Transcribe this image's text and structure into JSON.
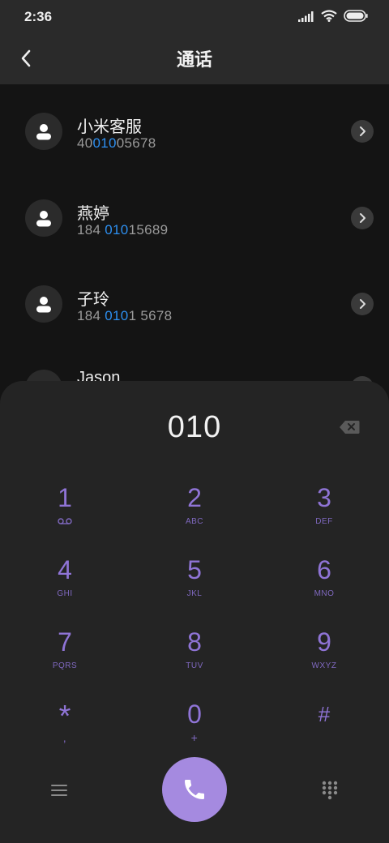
{
  "status": {
    "time": "2:36"
  },
  "header": {
    "title": "通话"
  },
  "contacts": [
    {
      "name": "小米客服",
      "number_parts": [
        "40",
        "010",
        "05678"
      ]
    },
    {
      "name": "燕婷",
      "number_parts": [
        "184 ",
        "010",
        "15689"
      ]
    },
    {
      "name": "子玲",
      "number_parts": [
        "184 ",
        "010",
        "1 5678"
      ]
    },
    {
      "name": "Jason",
      "number_parts": [
        "",
        "",
        ""
      ]
    }
  ],
  "dialpad": {
    "display": "010",
    "keys": [
      {
        "digit": "1",
        "letters": ""
      },
      {
        "digit": "2",
        "letters": "ABC"
      },
      {
        "digit": "3",
        "letters": "DEF"
      },
      {
        "digit": "4",
        "letters": "GHI"
      },
      {
        "digit": "5",
        "letters": "JKL"
      },
      {
        "digit": "6",
        "letters": "MNO"
      },
      {
        "digit": "7",
        "letters": "PQRS"
      },
      {
        "digit": "8",
        "letters": "TUV"
      },
      {
        "digit": "9",
        "letters": "WXYZ"
      },
      {
        "digit": "*",
        "letters": ","
      },
      {
        "digit": "0",
        "letters": "+"
      },
      {
        "digit": "#",
        "letters": ""
      }
    ]
  },
  "colors": {
    "accent": "#a58ae0",
    "key_text": "#8f74d6",
    "match_highlight": "#2d8ff0"
  },
  "icons": [
    "signal-icon",
    "wifi-icon",
    "battery-icon",
    "back-arrow-icon",
    "person-icon",
    "chevron-right-icon",
    "backspace-icon",
    "voicemail-icon",
    "menu-icon",
    "phone-icon",
    "dialpad-icon"
  ]
}
